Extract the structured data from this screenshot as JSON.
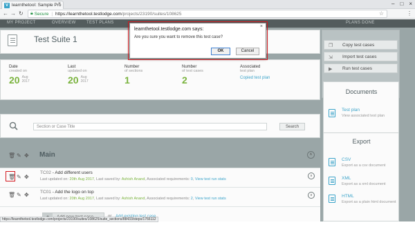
{
  "browser": {
    "tab_title": "learnthetool: Sample Pro",
    "secure_label": "Secure",
    "url_host": "https://learnthetool.testlodge.com",
    "url_path": "/projects/23190/suites/108625"
  },
  "topnav": {
    "items": [
      "MY PROJECT",
      "OVERVIEW",
      "TEST PLANS",
      "PLANS DONE"
    ]
  },
  "suite": {
    "title": "Test Suite 1",
    "stats": [
      {
        "label": "Date",
        "sub": "created on",
        "value": "20",
        "extra1": "Aug",
        "extra2": "2017"
      },
      {
        "label": "Last",
        "sub": "updated on",
        "value": "20",
        "extra1": "Aug",
        "extra2": "2017"
      },
      {
        "label": "Number",
        "sub": "of sections",
        "value": "1"
      },
      {
        "label": "Number",
        "sub": "of test cases",
        "value": "2"
      },
      {
        "label": "Associated",
        "sub": "test plan",
        "link": "Copied test plan"
      }
    ]
  },
  "search": {
    "placeholder": "Section or Case Title",
    "button": "Search"
  },
  "section": {
    "title": "Main"
  },
  "test_cases": [
    {
      "id": "TC02",
      "title": "Add different users",
      "meta_prefix": "Last updated on:",
      "date": "20th Aug 2017",
      "saved_prefix": ", Last saved by:",
      "user": "Ashish Anand",
      "req_prefix": ", Associated requirements:",
      "req_count": "0",
      "stats_link": "View test run stats"
    },
    {
      "id": "TC01",
      "title": "Add the logo on top",
      "meta_prefix": "Last updated on:",
      "date": "20th Aug 2017",
      "saved_prefix": ", Last saved by:",
      "user": "Ashish Anand",
      "req_prefix": ", Associated requirements:",
      "req_count": "2",
      "stats_link": "View test run stats"
    }
  ],
  "add": {
    "new_label": "Add new test case",
    "or_label": "or",
    "existing_label": "Add existing test case"
  },
  "actions": [
    {
      "label": "Copy test cases"
    },
    {
      "label": "Import test cases"
    },
    {
      "label": "Run test cases"
    }
  ],
  "documents": {
    "title": "Documents",
    "link": "Test plan",
    "desc": "View associated test plan"
  },
  "export": {
    "title": "Export",
    "items": [
      {
        "link": "CSV",
        "desc": "Export as a csv document"
      },
      {
        "link": "XML",
        "desc": "Export as a xml document"
      },
      {
        "link": "HTML",
        "desc": "Export as a plain html document"
      }
    ]
  },
  "status_bar": {
    "url": "https://learnthetool.testlodge.com/projects/23190/suites/108625/suite_sections/88433/steps/1766112"
  },
  "dialog": {
    "title": "learnthetool.testlodge.com says:",
    "message": "Are you sure you want to remove this test case?",
    "ok": "OK",
    "cancel": "Cancel"
  },
  "colors": {
    "accent_green": "#7ab33e",
    "link_blue": "#3aa3c9",
    "highlight_red": "#d3191f",
    "overlay": "#9aa6a7"
  }
}
